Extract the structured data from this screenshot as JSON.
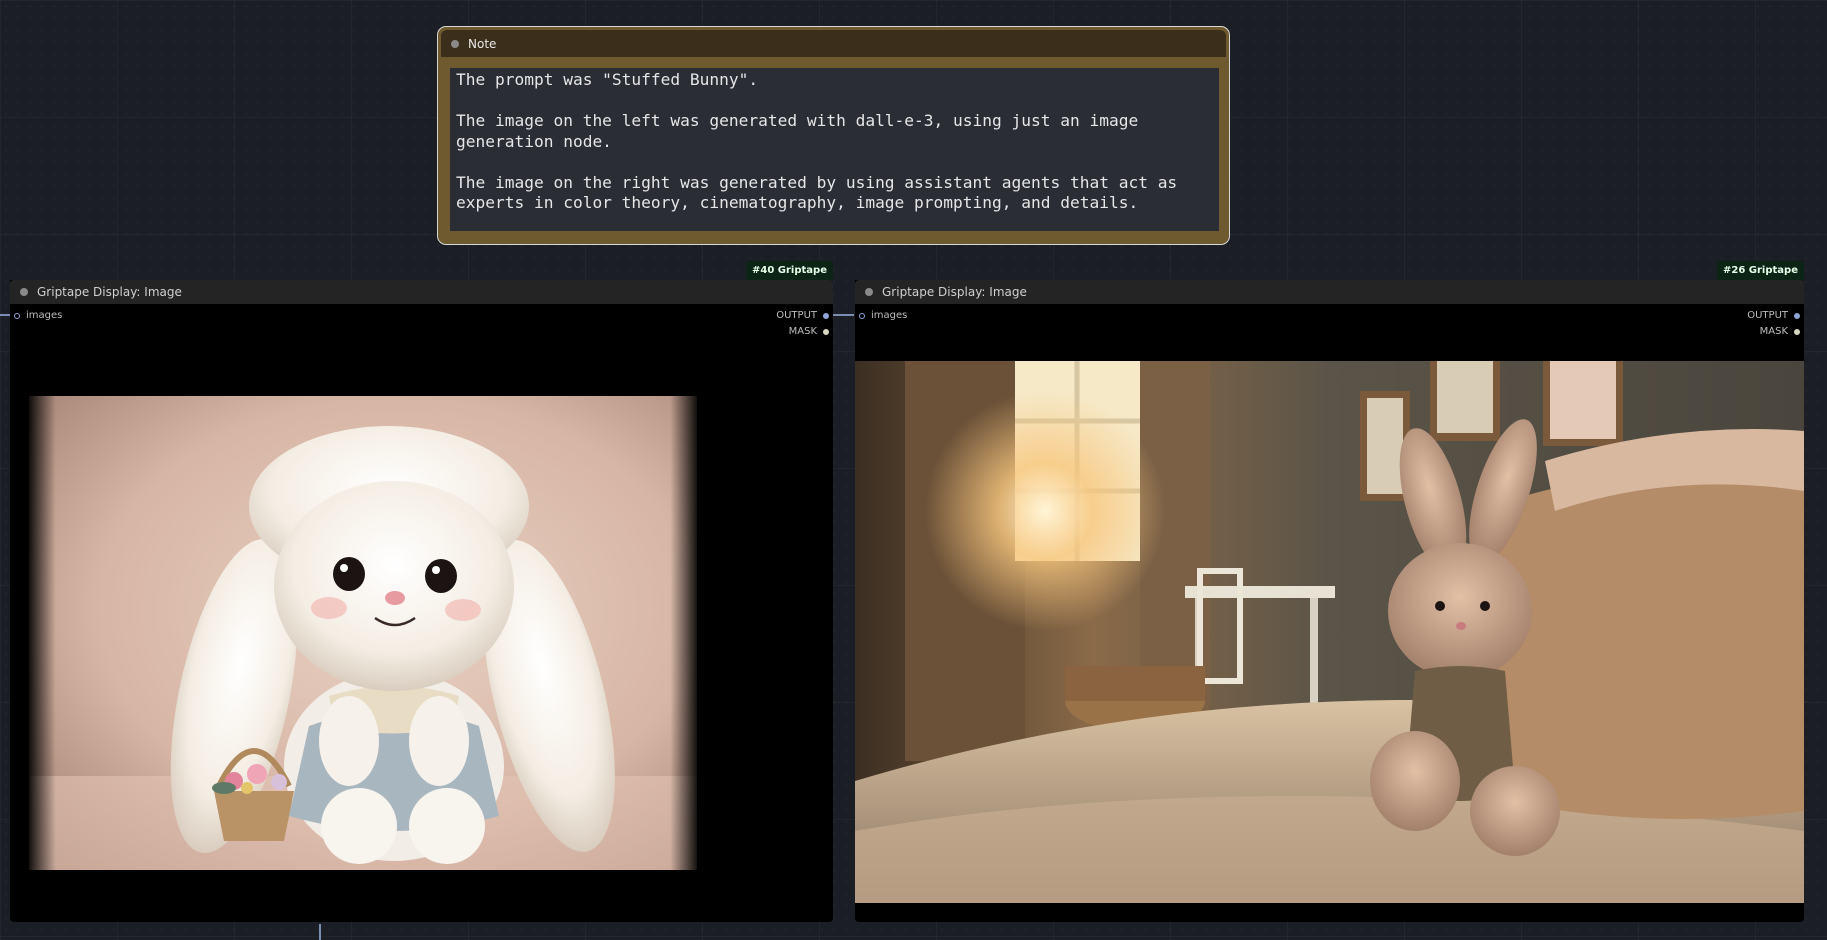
{
  "note": {
    "title": "Note",
    "text": "The prompt was \"Stuffed Bunny\".\n\nThe image on the left was generated with dall-e-3, using just an image generation node.\n\nThe image on the right was generated by using assistant agents that act as experts in color theory, cinematography, image prompting, and details."
  },
  "nodes": [
    {
      "badge": "#40 Griptape",
      "title": "Griptape Display: Image",
      "input_label": "images",
      "output_label": "OUTPUT",
      "mask_label": "MASK",
      "image": "fluffy white stuffed bunny with basket of flowers"
    },
    {
      "badge": "#26 Griptape",
      "title": "Griptape Display: Image",
      "input_label": "images",
      "output_label": "OUTPUT",
      "mask_label": "MASK",
      "image": "stuffed bunny on bed in sunlit bedroom"
    }
  ],
  "colors": {
    "note_frame": "#6e5a2e",
    "note_header": "#3b2f1b",
    "badge_bg": "#0b2415",
    "slot_blue": "#8fa7d8"
  }
}
